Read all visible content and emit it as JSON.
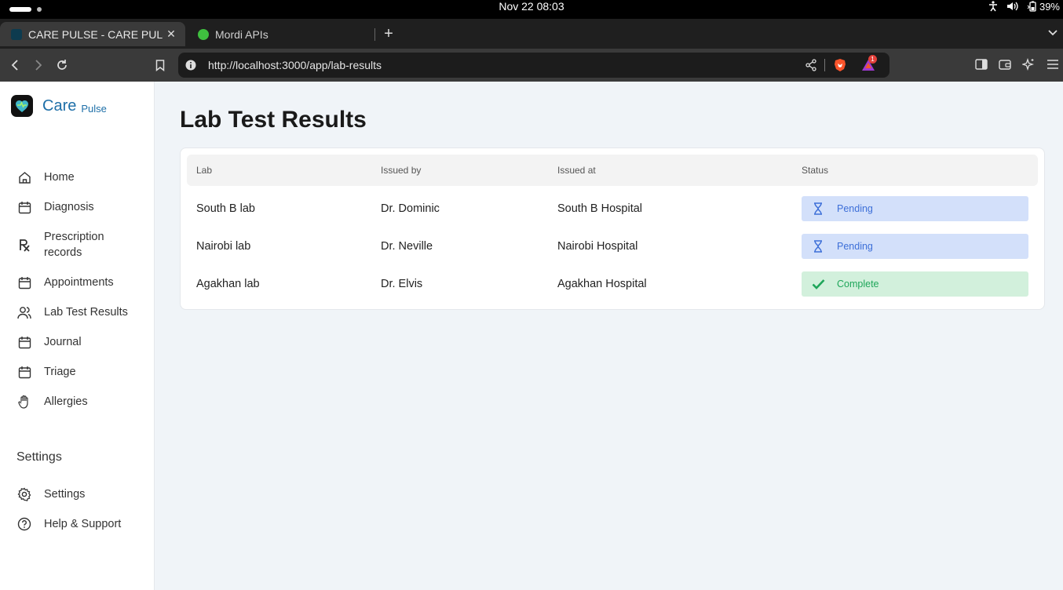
{
  "os": {
    "clock": "Nov 22  08:03",
    "battery": "39%"
  },
  "browser": {
    "tabs": [
      {
        "title": "CARE PULSE - CARE PULSE",
        "active": true
      },
      {
        "title": "Mordi APIs",
        "active": false
      }
    ],
    "url": "http://localhost:3000/app/lab-results",
    "notification_count": "1"
  },
  "app": {
    "brand": {
      "name": "Care",
      "sub": "Pulse"
    },
    "nav": [
      {
        "label": "Home",
        "icon": "home-icon"
      },
      {
        "label": "Diagnosis",
        "icon": "calendar-icon"
      },
      {
        "label": "Prescription records",
        "icon": "rx-icon"
      },
      {
        "label": "Appointments",
        "icon": "calendar-icon"
      },
      {
        "label": "Lab Test Results",
        "icon": "users-icon"
      },
      {
        "label": "Journal",
        "icon": "calendar-icon"
      },
      {
        "label": "Triage",
        "icon": "calendar-icon"
      },
      {
        "label": "Allergies",
        "icon": "hand-icon"
      }
    ],
    "settings_heading": "Settings",
    "settings_nav": [
      {
        "label": "Settings",
        "icon": "gear-icon"
      },
      {
        "label": "Help & Support",
        "icon": "help-icon"
      }
    ]
  },
  "page": {
    "title": "Lab Test Results",
    "columns": [
      "Lab",
      "Issued by",
      "Issued at",
      "Status"
    ],
    "rows": [
      {
        "lab": "South B lab",
        "issued_by": "Dr. Dominic",
        "issued_at": "South B Hospital",
        "status": "Pending"
      },
      {
        "lab": "Nairobi lab",
        "issued_by": "Dr. Neville",
        "issued_at": "Nairobi Hospital",
        "status": "Pending"
      },
      {
        "lab": "Agakhan lab",
        "issued_by": "Dr. Elvis",
        "issued_at": "Agakhan Hospital",
        "status": "Complete"
      }
    ]
  },
  "colors": {
    "brand": "#1e6fa8",
    "pending_bg": "#d3e0fa",
    "pending_fg": "#3d6fd8",
    "complete_bg": "#d2f0dc",
    "complete_fg": "#1fa65a"
  }
}
